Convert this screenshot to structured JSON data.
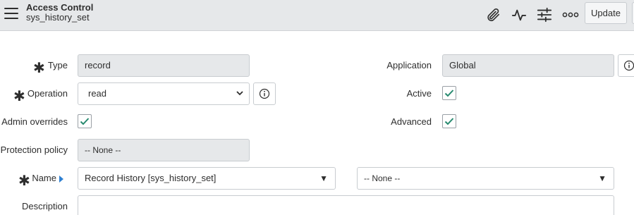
{
  "header": {
    "title": "Access Control",
    "subtitle": "sys_history_set",
    "icons": [
      "menu-icon",
      "attachment-icon",
      "activity-icon",
      "settings-sliders-icon",
      "more-icon"
    ],
    "update_label": "Update"
  },
  "form": {
    "type": {
      "label": "Type",
      "value": "record",
      "required": true
    },
    "operation": {
      "label": "Operation",
      "value": "read",
      "required": true
    },
    "admin_overrides": {
      "label": "Admin overrides",
      "checked": true
    },
    "protection_policy": {
      "label": "Protection policy",
      "value": "-- None --"
    },
    "name": {
      "label": "Name",
      "table_value": "Record History [sys_history_set]",
      "field_value": "-- None --",
      "required": true
    },
    "description": {
      "label": "Description",
      "value": ""
    },
    "application": {
      "label": "Application",
      "value": "Global"
    },
    "active": {
      "label": "Active",
      "checked": true
    },
    "advanced": {
      "label": "Advanced",
      "checked": true
    }
  },
  "colors": {
    "header_bg": "#e6e8ea",
    "check": "#278a6f",
    "lookup_arrow": "#2f80d1"
  }
}
